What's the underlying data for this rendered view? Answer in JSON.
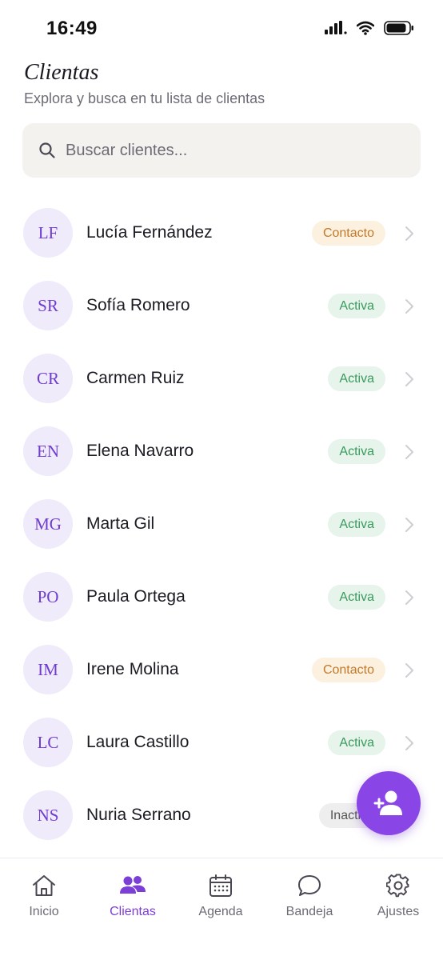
{
  "status_bar": {
    "time": "16:49"
  },
  "header": {
    "title": "Clientas",
    "subtitle": "Explora y busca en tu lista de clientas"
  },
  "search": {
    "placeholder": "Buscar clientes..."
  },
  "clients": [
    {
      "initials": "LF",
      "name": "Lucía Fernández",
      "status": "Contacto",
      "status_type": "contacto"
    },
    {
      "initials": "SR",
      "name": "Sofía Romero",
      "status": "Activa",
      "status_type": "activa"
    },
    {
      "initials": "CR",
      "name": "Carmen Ruiz",
      "status": "Activa",
      "status_type": "activa"
    },
    {
      "initials": "EN",
      "name": "Elena Navarro",
      "status": "Activa",
      "status_type": "activa"
    },
    {
      "initials": "MG",
      "name": "Marta Gil",
      "status": "Activa",
      "status_type": "activa"
    },
    {
      "initials": "PO",
      "name": "Paula Ortega",
      "status": "Activa",
      "status_type": "activa"
    },
    {
      "initials": "IM",
      "name": "Irene Molina",
      "status": "Contacto",
      "status_type": "contacto"
    },
    {
      "initials": "LC",
      "name": "Laura Castillo",
      "status": "Activa",
      "status_type": "activa"
    },
    {
      "initials": "NS",
      "name": "Nuria Serrano",
      "status": "Inactiva",
      "status_type": "inactiva"
    }
  ],
  "fab": {
    "icon": "add-user-icon"
  },
  "tabbar": {
    "tabs": [
      {
        "label": "Inicio",
        "icon": "home-icon",
        "active": false
      },
      {
        "label": "Clientas",
        "icon": "users-icon",
        "active": true
      },
      {
        "label": "Agenda",
        "icon": "calendar-icon",
        "active": false
      },
      {
        "label": "Bandeja",
        "icon": "chat-bubble-icon",
        "active": false
      },
      {
        "label": "Ajustes",
        "icon": "gear-icon",
        "active": false
      }
    ]
  },
  "colors": {
    "accent": "#8a45e6",
    "avatar_bg": "#efebfb",
    "contacto_bg": "#fcf0df",
    "activa_bg": "#e6f4ec"
  }
}
